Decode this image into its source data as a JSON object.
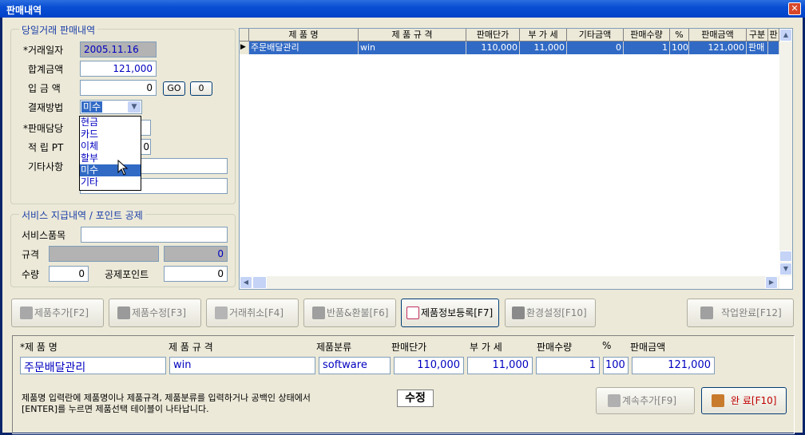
{
  "window": {
    "title": "판매내역",
    "close_glyph": "✕"
  },
  "left_panel": {
    "group_title": "당일거래 판매내역",
    "trade_date_label": "*거래일자",
    "trade_date": "2005.11.16",
    "total_label": "합계금액",
    "total": "121,000",
    "deposit_label": "입 금 액",
    "deposit": "0",
    "go_label": "GO",
    "zero_label": "0",
    "payment_label": "결재방법",
    "payment_selected": "미수",
    "seller_label": "*판매담당",
    "points_label": "적 립 PT",
    "points_value": "0",
    "memo_label": "기타사항",
    "payment_options": [
      "현금",
      "카드",
      "이체",
      "할부",
      "미수",
      "기타"
    ],
    "highlighted_option": "미수"
  },
  "service_panel": {
    "group_title": "서비스 지급내역 / 포인트 공제",
    "item_label": "서비스품목",
    "spec_label": "규격",
    "spec_value": "0",
    "qty_label": "수량",
    "qty_value": "0",
    "deduct_label": "공제포인트",
    "deduct_value": "0"
  },
  "grid": {
    "columns": [
      "제 품 명",
      "제 품 규 격",
      "판매단가",
      "부 가 세",
      "기타금액",
      "판매수량",
      "%",
      "판매금액",
      "구분",
      "판"
    ],
    "rows": [
      [
        "주문배달관리",
        "win",
        "110,000",
        "11,000",
        "0",
        "1",
        "100",
        "121,000",
        "판매",
        ""
      ]
    ],
    "row_marker": "▶"
  },
  "toolbar": {
    "add_product": "제품추가[F2]",
    "edit_product": "제품수정[F3]",
    "cancel_trade": "거래취소[F4]",
    "return_refund": "반품&환불[F6]",
    "product_register": "제품정보등록[F7]",
    "settings": "환경설정[F10]",
    "finish_work": "작업완료[F12]"
  },
  "entry": {
    "h_name": "*제 품 명",
    "h_spec": "제 품 규 격",
    "h_category": "제품분류",
    "h_price": "판매단가",
    "h_vat": "부 가 세",
    "h_qty": "판매수량",
    "h_pct": "%",
    "h_amount": "판매금액",
    "name": "주문배달관리",
    "spec": "win",
    "category": "software",
    "price": "110,000",
    "vat": "11,000",
    "qty": "1",
    "pct": "100",
    "amount": "121,000",
    "note_line1": "제품명 입력란에 제품명이나 제품규격, 제품분류를 입력하거나 공백인 상태에서",
    "note_line2": "[ENTER]를 누르면 제품선택 테이블이 나타납니다.",
    "mode": "수정",
    "continue_add": "계속추가[F9]",
    "complete": "완 료[F10]"
  },
  "colors": {
    "title_bar": "#0a4fd3",
    "selection": "#316ac5",
    "face": "#ece9d8",
    "complete_text": "#c00000"
  }
}
